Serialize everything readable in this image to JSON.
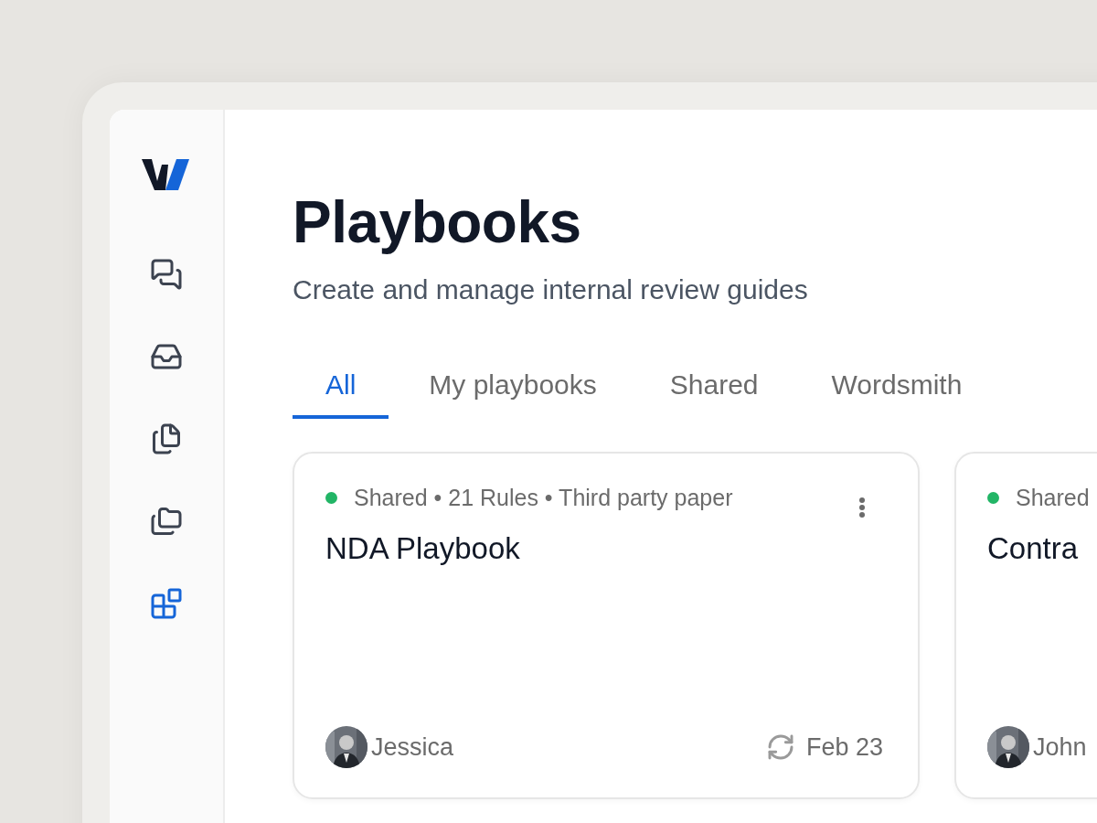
{
  "sidebar": {
    "items": [
      {
        "kind": "chats",
        "selected": false
      },
      {
        "kind": "inbox",
        "selected": false
      },
      {
        "kind": "documents",
        "selected": false
      },
      {
        "kind": "folders",
        "selected": false
      },
      {
        "kind": "blocks",
        "selected": true
      }
    ]
  },
  "header": {
    "title": "Playbooks",
    "subtitle": "Create and manage internal review guides"
  },
  "tabs": [
    {
      "label": "All",
      "selected": true
    },
    {
      "label": "My playbooks",
      "selected": false
    },
    {
      "label": "Shared",
      "selected": false
    },
    {
      "label": "Wordsmith",
      "selected": false
    }
  ],
  "cards": [
    {
      "color": "#22b566",
      "meta": "Shared • 21 Rules • Third party paper",
      "title": "NDA Playbook",
      "owner": "Jessica",
      "date": "Feb 23",
      "menu": true
    },
    {
      "color": "#22b566",
      "meta": "Shared",
      "title": "Contra",
      "owner": "John"
    }
  ]
}
